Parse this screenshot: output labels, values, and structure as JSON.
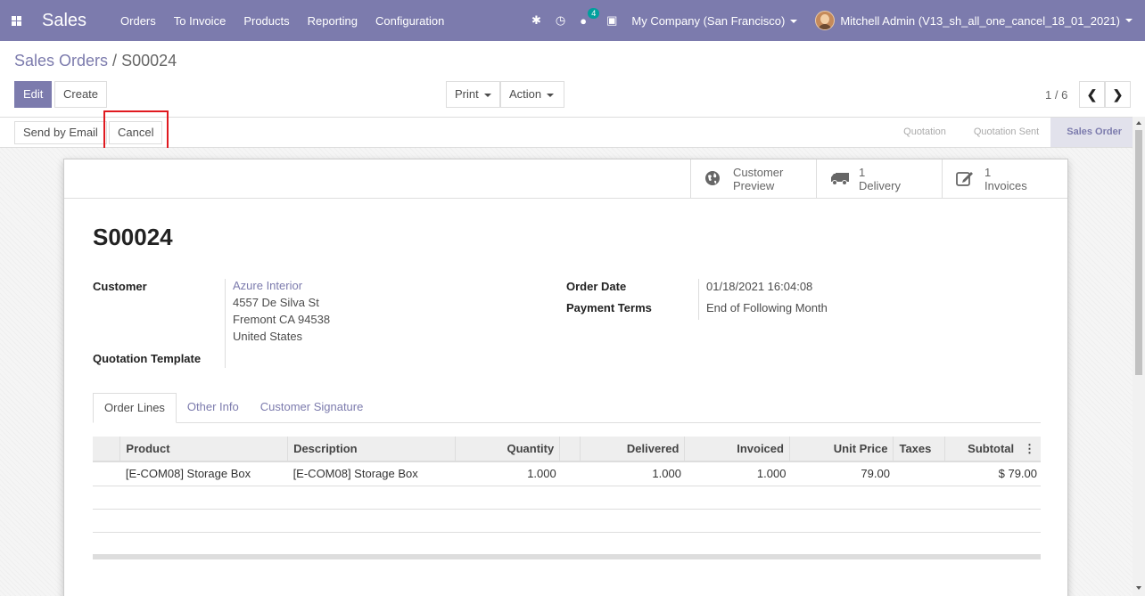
{
  "navbar": {
    "app_name": "Sales",
    "menu": [
      "Orders",
      "To Invoice",
      "Products",
      "Reporting",
      "Configuration"
    ],
    "messages_count": "4",
    "company": "My Company (San Francisco)",
    "user": "Mitchell Admin (V13_sh_all_one_cancel_18_01_2021)"
  },
  "breadcrumb": {
    "parent": "Sales Orders",
    "separator": " / ",
    "current": "S00024"
  },
  "toolbar": {
    "edit": "Edit",
    "create": "Create",
    "print": "Print",
    "action": "Action"
  },
  "pager": {
    "value": "1 / 6"
  },
  "statusbar": {
    "send_email": "Send by Email",
    "cancel": "Cancel",
    "steps": [
      "Quotation",
      "Quotation Sent",
      "Sales Order"
    ]
  },
  "smart_buttons": {
    "preview": {
      "line1": "Customer",
      "line2": "Preview"
    },
    "delivery": {
      "count": "1",
      "label": "Delivery"
    },
    "invoices": {
      "count": "1",
      "label": "Invoices"
    }
  },
  "form": {
    "title": "S00024",
    "customer_label": "Customer",
    "customer_name": "Azure Interior",
    "address": [
      "4557 De Silva St",
      "Fremont CA 94538",
      "United States"
    ],
    "quotation_template_label": "Quotation Template",
    "order_date_label": "Order Date",
    "order_date": "01/18/2021 16:04:08",
    "payment_terms_label": "Payment Terms",
    "payment_terms": "End of Following Month"
  },
  "tabs": [
    "Order Lines",
    "Other Info",
    "Customer Signature"
  ],
  "order_lines": {
    "columns": [
      "Product",
      "Description",
      "Quantity",
      "Delivered",
      "Invoiced",
      "Unit Price",
      "Taxes",
      "Subtotal"
    ],
    "rows": [
      {
        "product": "[E-COM08] Storage Box",
        "description": "[E-COM08] Storage Box",
        "quantity": "1.000",
        "delivered": "1.000",
        "invoiced": "1.000",
        "unit_price": "79.00",
        "taxes": "",
        "subtotal": "$ 79.00"
      }
    ]
  }
}
